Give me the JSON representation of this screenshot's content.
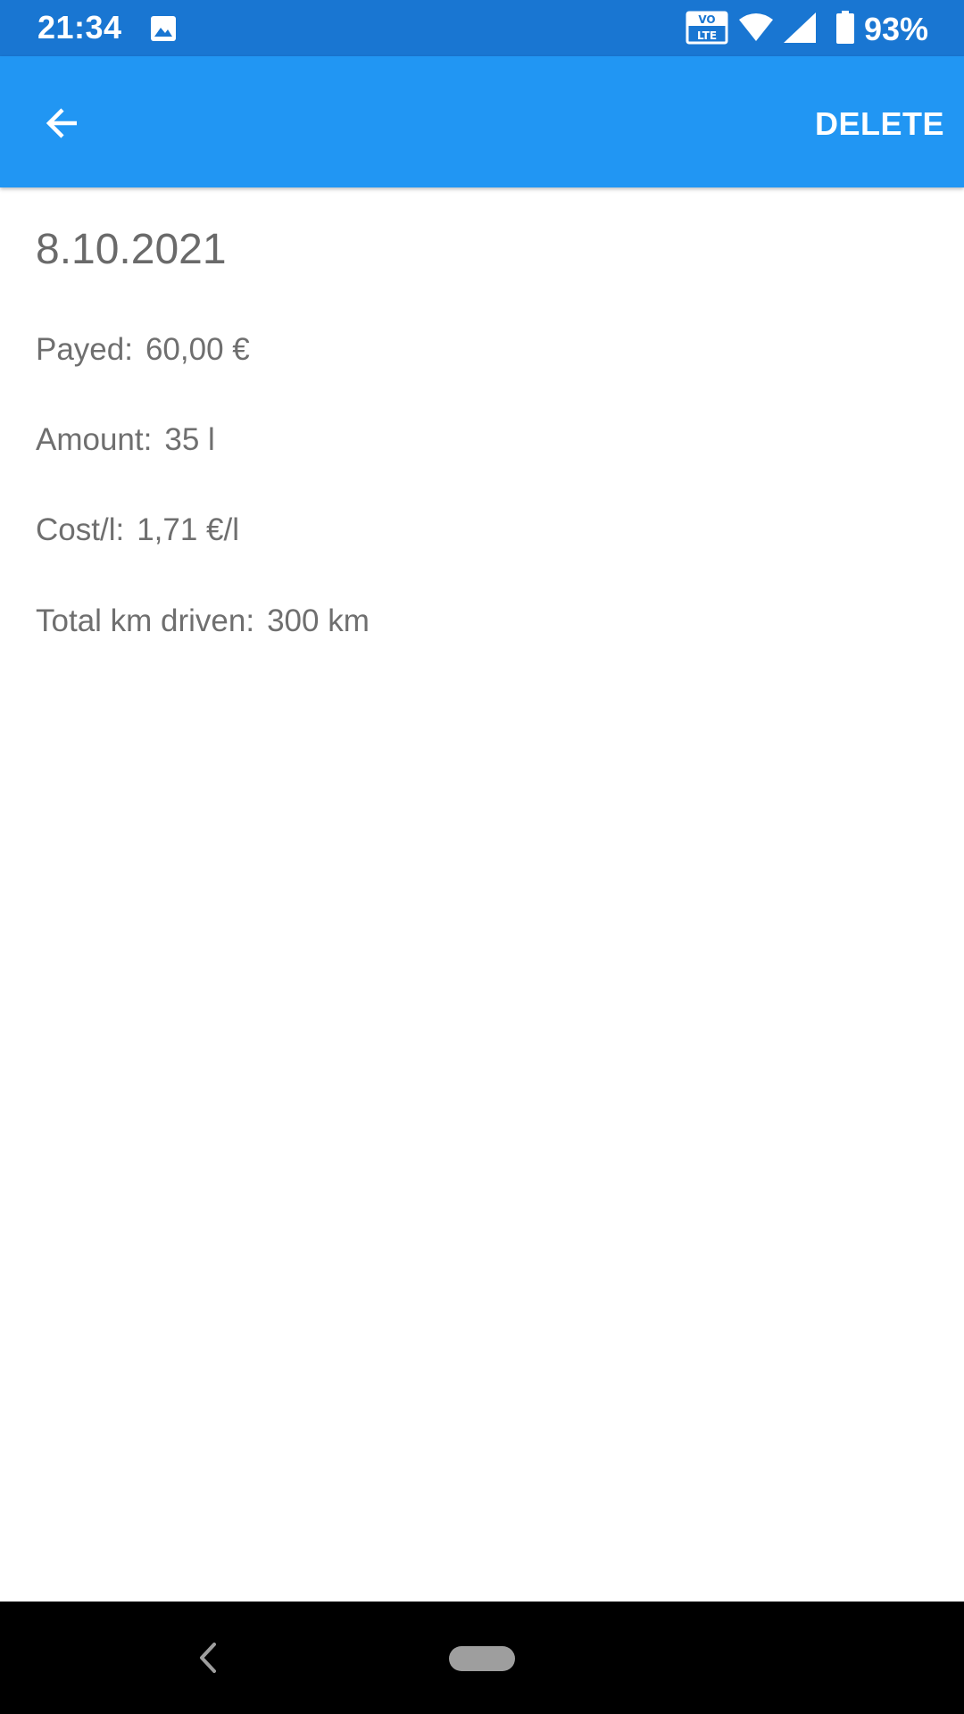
{
  "status_bar": {
    "time": "21:34",
    "battery": "93%",
    "icons": [
      "gallery-icon",
      "volte-icon",
      "wifi-icon",
      "signal-icon",
      "battery-icon"
    ]
  },
  "app_bar": {
    "back_icon": "arrow-back-icon",
    "delete_label": "DELETE",
    "color": "#2196F3"
  },
  "entry": {
    "date": "8.10.2021",
    "payed_label": "Payed:",
    "payed_value": "60,00 €",
    "amount_label": "Amount:",
    "amount_value": "35 l",
    "cost_label": "Cost/l:",
    "cost_value": "1,71 €/l",
    "km_label": "Total km driven:",
    "km_value": "300 km"
  },
  "nav_bar": {
    "back_icon": "chevron-left-icon",
    "home_icon": "home-pill-icon"
  },
  "colors": {
    "status_bar": "#1976D2",
    "app_bar": "#2196F3",
    "text": "#6f6f6f"
  }
}
